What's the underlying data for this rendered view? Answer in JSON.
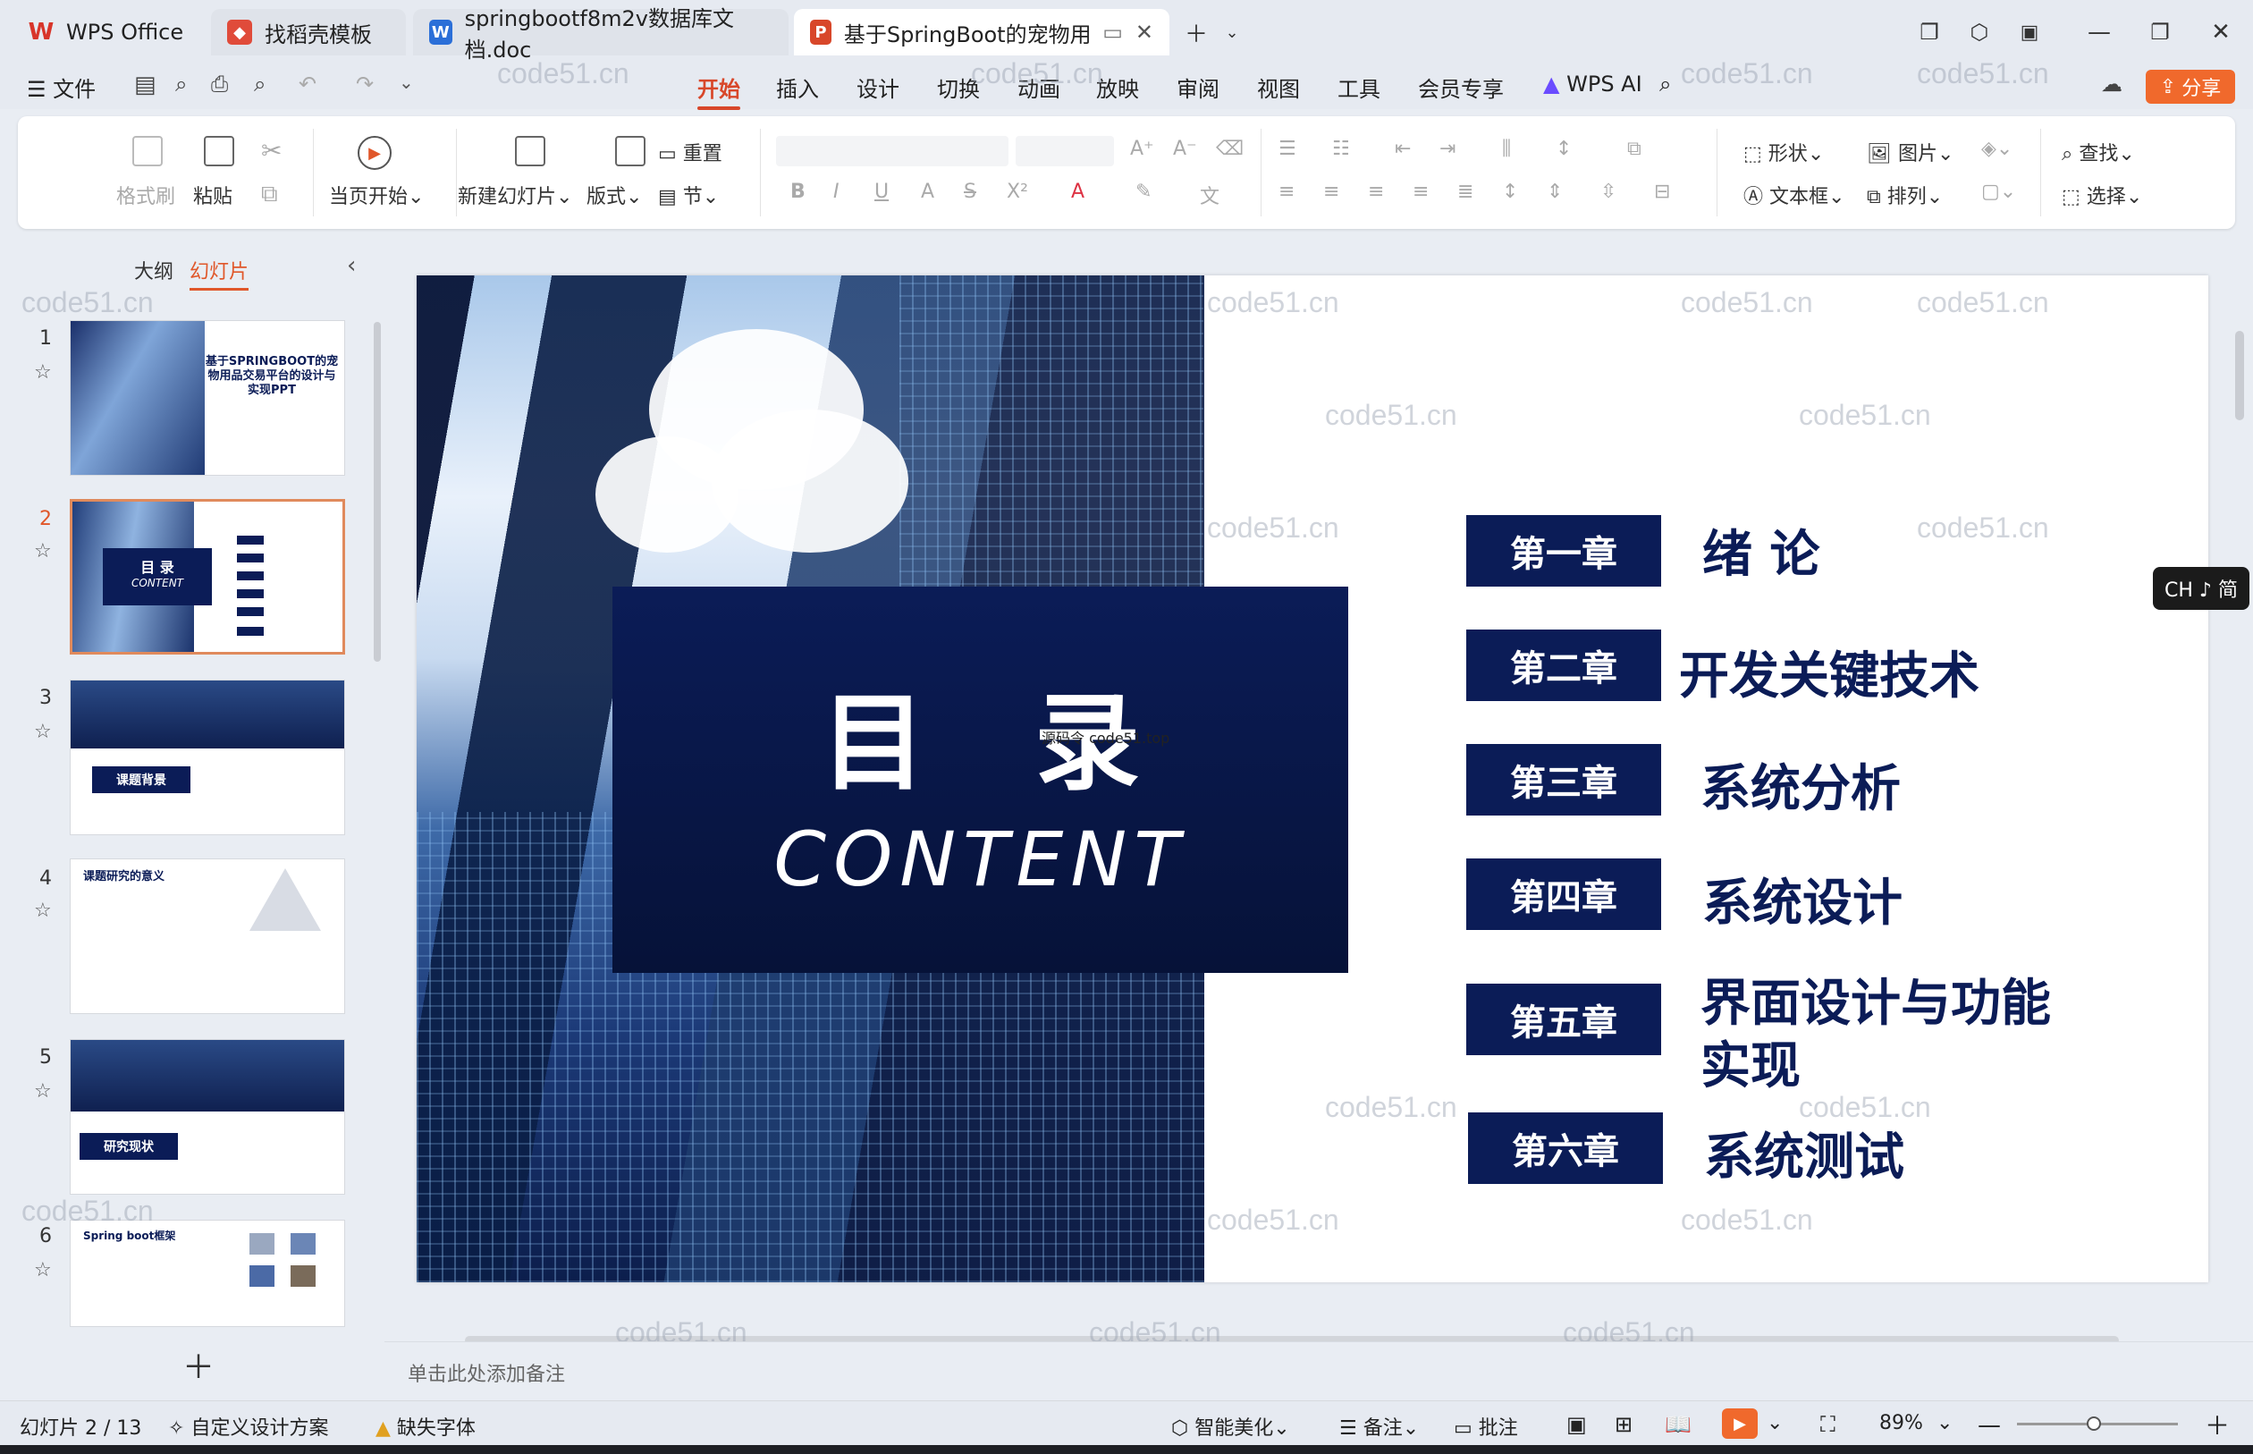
{
  "titlebar": {
    "tabs": [
      {
        "label": "WPS Office"
      },
      {
        "label": "找稻壳模板"
      },
      {
        "label": "springbootf8m2v数据库文档.doc"
      },
      {
        "label": "基于SpringBoot的宠物用品交"
      }
    ]
  },
  "menubar": {
    "file": "文件",
    "items": [
      "开始",
      "插入",
      "设计",
      "切换",
      "动画",
      "放映",
      "审阅",
      "视图",
      "工具",
      "会员专享"
    ],
    "wps_ai": "WPS AI",
    "share": "分享"
  },
  "ribbon": {
    "format_painter": "格式刷",
    "paste": "粘贴",
    "from_current": "当页开始",
    "new_slide": "新建幻灯片",
    "layout": "版式",
    "reset": "重置",
    "section": "节",
    "shape": "形状",
    "picture": "图片",
    "textbox": "文本框",
    "arrange": "排列",
    "find": "查找",
    "select": "选择"
  },
  "leftpanel": {
    "outline": "大纲",
    "slides": "幻灯片",
    "numbers": [
      "1",
      "2",
      "3",
      "4",
      "5",
      "6"
    ],
    "thumb1_title": "基于SPRINGBOOT的宠物用品交易平台的设计与实现PPT",
    "thumb2_title": "目 录",
    "thumb2_sub": "CONTENT",
    "thumb3_label": "课题背景",
    "thumb4_label": "课题研究的意义",
    "thumb5_label": "研究现状",
    "thumb6_label": "Spring boot框架"
  },
  "slide": {
    "title_zh": "目 录",
    "title_en": "CONTENT",
    "overlay_text": "源码令 code51.top",
    "chapters": [
      {
        "badge": "第一章",
        "title": "绪 论"
      },
      {
        "badge": "第二章",
        "title": "开发关键技术"
      },
      {
        "badge": "第三章",
        "title": "系统分析"
      },
      {
        "badge": "第四章",
        "title": "系统设计"
      },
      {
        "badge": "第五章",
        "title": "界面设计与功能实现"
      },
      {
        "badge": "第六章",
        "title": "系统测试"
      }
    ]
  },
  "notes": {
    "placeholder": "单击此处添加备注"
  },
  "ime": "CH ♪ 简",
  "watermark": "code51.cn",
  "status": {
    "slide_index": "幻灯片 2 / 13",
    "custom_design": "自定义设计方案",
    "missing_font": "缺失字体",
    "smart_beautify": "智能美化",
    "notes": "备注",
    "comments": "批注",
    "zoom": "89%"
  },
  "colors": {
    "accent": "#d8472a",
    "navy": "#0b1c57",
    "share_btn": "#f0692c"
  }
}
